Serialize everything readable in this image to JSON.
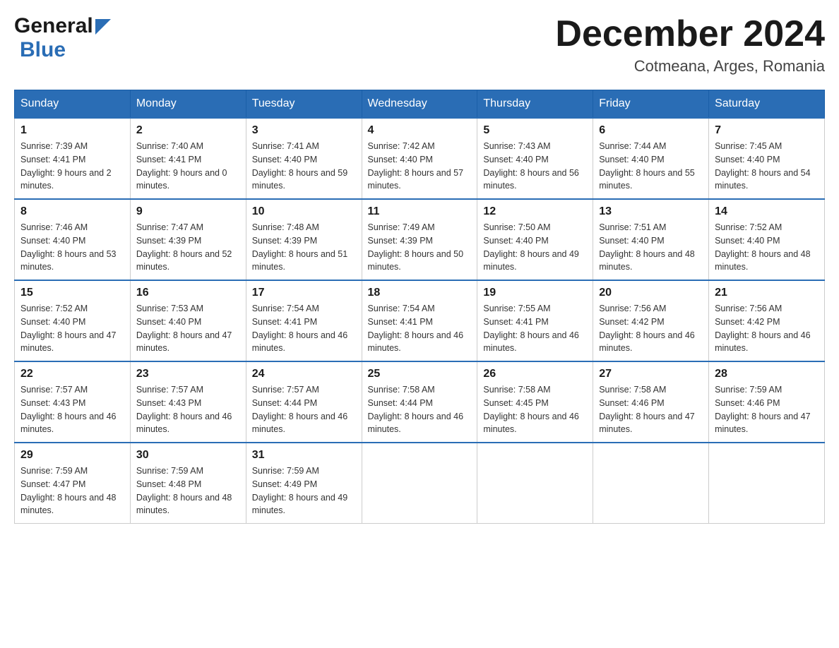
{
  "header": {
    "logo_general": "General",
    "logo_blue": "Blue",
    "month_title": "December 2024",
    "location": "Cotmeana, Arges, Romania"
  },
  "days_of_week": [
    "Sunday",
    "Monday",
    "Tuesday",
    "Wednesday",
    "Thursday",
    "Friday",
    "Saturday"
  ],
  "weeks": [
    [
      {
        "day": "1",
        "sunrise": "7:39 AM",
        "sunset": "4:41 PM",
        "daylight": "9 hours and 2 minutes."
      },
      {
        "day": "2",
        "sunrise": "7:40 AM",
        "sunset": "4:41 PM",
        "daylight": "9 hours and 0 minutes."
      },
      {
        "day": "3",
        "sunrise": "7:41 AM",
        "sunset": "4:40 PM",
        "daylight": "8 hours and 59 minutes."
      },
      {
        "day": "4",
        "sunrise": "7:42 AM",
        "sunset": "4:40 PM",
        "daylight": "8 hours and 57 minutes."
      },
      {
        "day": "5",
        "sunrise": "7:43 AM",
        "sunset": "4:40 PM",
        "daylight": "8 hours and 56 minutes."
      },
      {
        "day": "6",
        "sunrise": "7:44 AM",
        "sunset": "4:40 PM",
        "daylight": "8 hours and 55 minutes."
      },
      {
        "day": "7",
        "sunrise": "7:45 AM",
        "sunset": "4:40 PM",
        "daylight": "8 hours and 54 minutes."
      }
    ],
    [
      {
        "day": "8",
        "sunrise": "7:46 AM",
        "sunset": "4:40 PM",
        "daylight": "8 hours and 53 minutes."
      },
      {
        "day": "9",
        "sunrise": "7:47 AM",
        "sunset": "4:39 PM",
        "daylight": "8 hours and 52 minutes."
      },
      {
        "day": "10",
        "sunrise": "7:48 AM",
        "sunset": "4:39 PM",
        "daylight": "8 hours and 51 minutes."
      },
      {
        "day": "11",
        "sunrise": "7:49 AM",
        "sunset": "4:39 PM",
        "daylight": "8 hours and 50 minutes."
      },
      {
        "day": "12",
        "sunrise": "7:50 AM",
        "sunset": "4:40 PM",
        "daylight": "8 hours and 49 minutes."
      },
      {
        "day": "13",
        "sunrise": "7:51 AM",
        "sunset": "4:40 PM",
        "daylight": "8 hours and 48 minutes."
      },
      {
        "day": "14",
        "sunrise": "7:52 AM",
        "sunset": "4:40 PM",
        "daylight": "8 hours and 48 minutes."
      }
    ],
    [
      {
        "day": "15",
        "sunrise": "7:52 AM",
        "sunset": "4:40 PM",
        "daylight": "8 hours and 47 minutes."
      },
      {
        "day": "16",
        "sunrise": "7:53 AM",
        "sunset": "4:40 PM",
        "daylight": "8 hours and 47 minutes."
      },
      {
        "day": "17",
        "sunrise": "7:54 AM",
        "sunset": "4:41 PM",
        "daylight": "8 hours and 46 minutes."
      },
      {
        "day": "18",
        "sunrise": "7:54 AM",
        "sunset": "4:41 PM",
        "daylight": "8 hours and 46 minutes."
      },
      {
        "day": "19",
        "sunrise": "7:55 AM",
        "sunset": "4:41 PM",
        "daylight": "8 hours and 46 minutes."
      },
      {
        "day": "20",
        "sunrise": "7:56 AM",
        "sunset": "4:42 PM",
        "daylight": "8 hours and 46 minutes."
      },
      {
        "day": "21",
        "sunrise": "7:56 AM",
        "sunset": "4:42 PM",
        "daylight": "8 hours and 46 minutes."
      }
    ],
    [
      {
        "day": "22",
        "sunrise": "7:57 AM",
        "sunset": "4:43 PM",
        "daylight": "8 hours and 46 minutes."
      },
      {
        "day": "23",
        "sunrise": "7:57 AM",
        "sunset": "4:43 PM",
        "daylight": "8 hours and 46 minutes."
      },
      {
        "day": "24",
        "sunrise": "7:57 AM",
        "sunset": "4:44 PM",
        "daylight": "8 hours and 46 minutes."
      },
      {
        "day": "25",
        "sunrise": "7:58 AM",
        "sunset": "4:44 PM",
        "daylight": "8 hours and 46 minutes."
      },
      {
        "day": "26",
        "sunrise": "7:58 AM",
        "sunset": "4:45 PM",
        "daylight": "8 hours and 46 minutes."
      },
      {
        "day": "27",
        "sunrise": "7:58 AM",
        "sunset": "4:46 PM",
        "daylight": "8 hours and 47 minutes."
      },
      {
        "day": "28",
        "sunrise": "7:59 AM",
        "sunset": "4:46 PM",
        "daylight": "8 hours and 47 minutes."
      }
    ],
    [
      {
        "day": "29",
        "sunrise": "7:59 AM",
        "sunset": "4:47 PM",
        "daylight": "8 hours and 48 minutes."
      },
      {
        "day": "30",
        "sunrise": "7:59 AM",
        "sunset": "4:48 PM",
        "daylight": "8 hours and 48 minutes."
      },
      {
        "day": "31",
        "sunrise": "7:59 AM",
        "sunset": "4:49 PM",
        "daylight": "8 hours and 49 minutes."
      },
      null,
      null,
      null,
      null
    ]
  ]
}
